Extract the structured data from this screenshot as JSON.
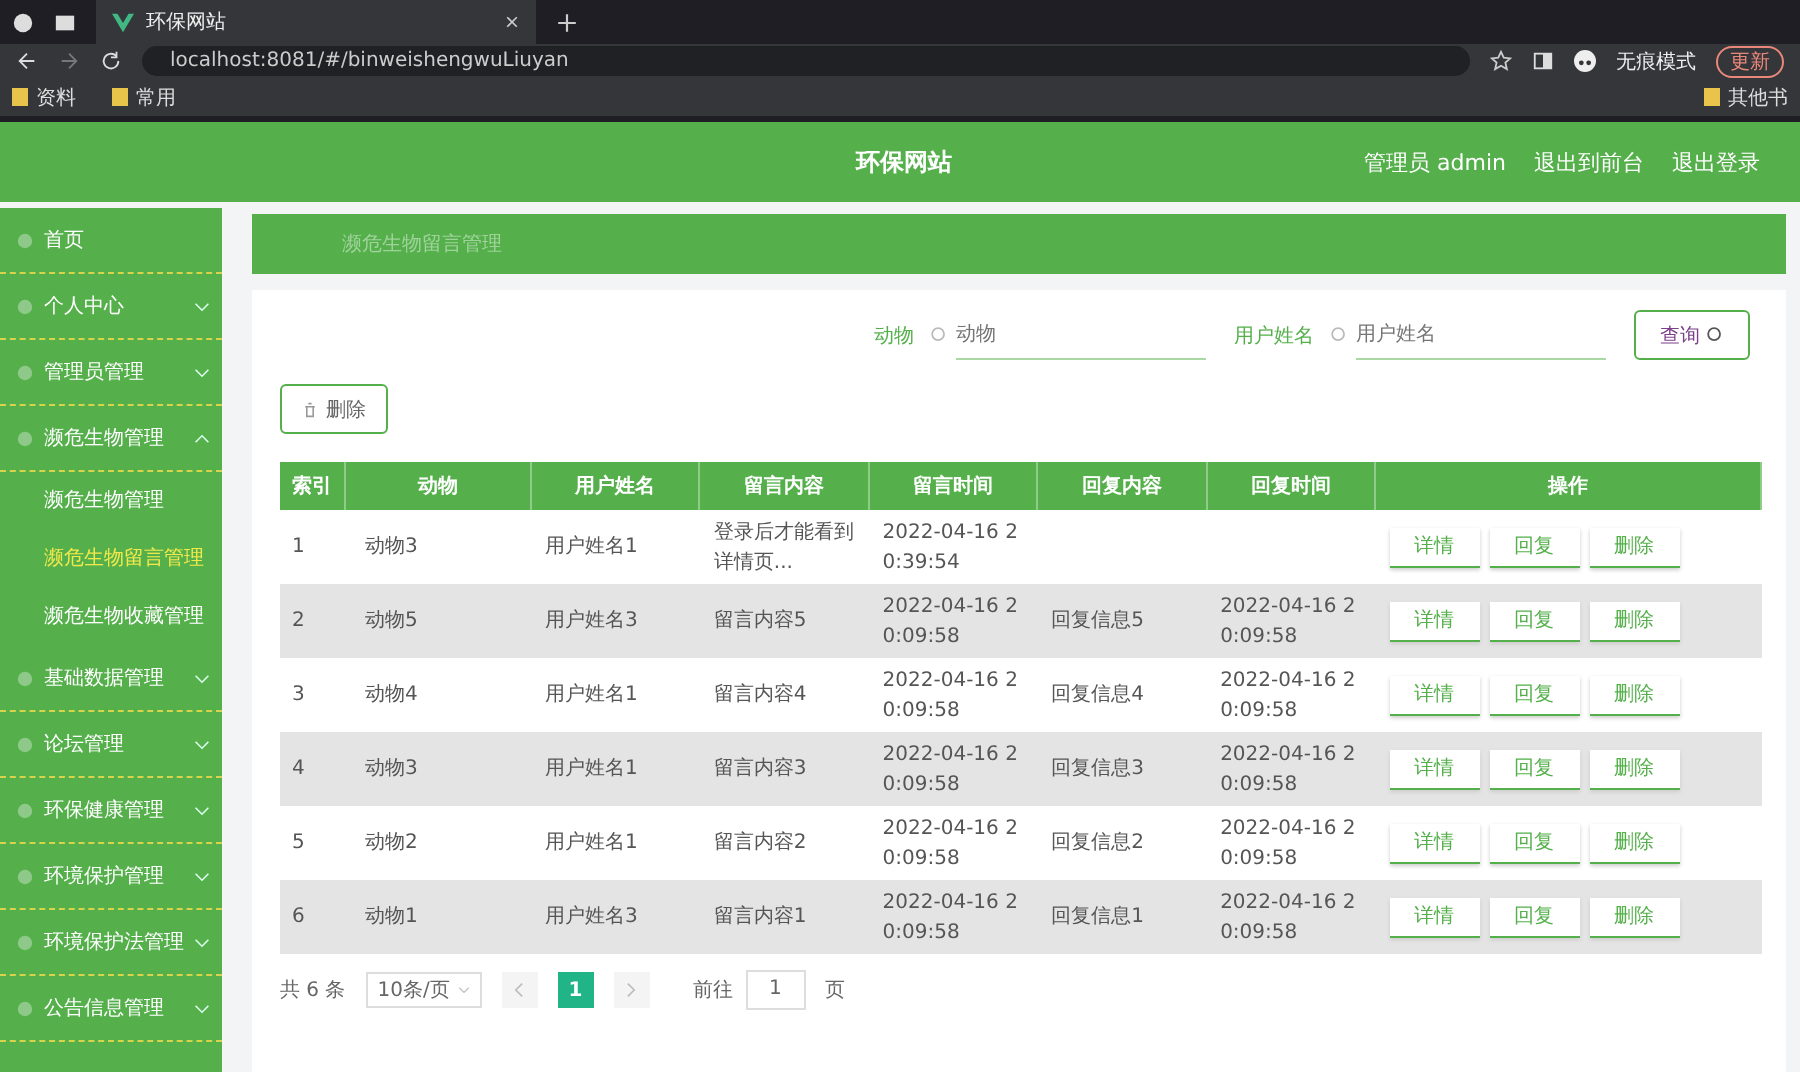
{
  "browser": {
    "tab_title": "环保网站",
    "url": "localhost:8081/#/binweishengwuLiuyan",
    "profile": "无痕模式",
    "update": "更新",
    "bookmarks": [
      "资料",
      "常用"
    ],
    "other_bookmarks": "其他书"
  },
  "header": {
    "title": "环保网站",
    "links": [
      "管理员 admin",
      "退出到前台",
      "退出登录"
    ]
  },
  "sidebar": {
    "items": [
      {
        "label": "首页"
      },
      {
        "label": "个人中心",
        "expanded": false
      },
      {
        "label": "管理员管理",
        "expanded": false
      },
      {
        "label": "濒危生物管理",
        "expanded": true,
        "children": [
          {
            "label": "濒危生物管理",
            "selected": false
          },
          {
            "label": "濒危生物留言管理",
            "selected": true
          },
          {
            "label": "濒危生物收藏管理",
            "selected": false
          }
        ]
      },
      {
        "label": "基础数据管理",
        "expanded": false
      },
      {
        "label": "论坛管理",
        "expanded": false
      },
      {
        "label": "环保健康管理",
        "expanded": false
      },
      {
        "label": "环境保护管理",
        "expanded": false
      },
      {
        "label": "环境保护法管理",
        "expanded": false
      },
      {
        "label": "公告信息管理",
        "expanded": false
      }
    ]
  },
  "breadcrumb": "濒危生物留言管理",
  "search": {
    "fields": [
      {
        "label": "动物",
        "placeholder": "动物"
      },
      {
        "label": "用户姓名",
        "placeholder": "用户姓名"
      }
    ],
    "button": "查询"
  },
  "delete_button": "删除",
  "table": {
    "columns": [
      "索引",
      "动物",
      "用户姓名",
      "留言内容",
      "留言时间",
      "回复内容",
      "回复时间",
      "操作"
    ],
    "rows": [
      {
        "cells": [
          "1",
          "动物3",
          "用户姓名1",
          "登录后才能看到详情页...",
          "2022-04-16 20:39:54",
          "",
          ""
        ],
        "actions": [
          "详情",
          "回复",
          "删除"
        ]
      },
      {
        "cells": [
          "2",
          "动物5",
          "用户姓名3",
          "留言内容5",
          "2022-04-16 20:09:58",
          "回复信息5",
          "2022-04-16 20:09:58"
        ],
        "actions": [
          "详情",
          "回复",
          "删除"
        ]
      },
      {
        "cells": [
          "3",
          "动物4",
          "用户姓名1",
          "留言内容4",
          "2022-04-16 20:09:58",
          "回复信息4",
          "2022-04-16 20:09:58"
        ],
        "actions": [
          "详情",
          "回复",
          "删除"
        ]
      },
      {
        "cells": [
          "4",
          "动物3",
          "用户姓名1",
          "留言内容3",
          "2022-04-16 20:09:58",
          "回复信息3",
          "2022-04-16 20:09:58"
        ],
        "actions": [
          "详情",
          "回复",
          "删除"
        ]
      },
      {
        "cells": [
          "5",
          "动物2",
          "用户姓名1",
          "留言内容2",
          "2022-04-16 20:09:58",
          "回复信息2",
          "2022-04-16 20:09:58"
        ],
        "actions": [
          "详情",
          "回复",
          "删除"
        ]
      },
      {
        "cells": [
          "6",
          "动物1",
          "用户姓名3",
          "留言内容1",
          "2022-04-16 20:09:58",
          "回复信息1",
          "2022-04-16 20:09:58"
        ],
        "actions": [
          "详情",
          "回复",
          "删除"
        ]
      }
    ]
  },
  "pagination": {
    "total": "共 6 条",
    "page_size": "10条/页",
    "pages": [
      {
        "label": "1",
        "selected": true
      }
    ],
    "goto_label": "前往",
    "goto_value": "1",
    "goto_suffix": "页"
  }
}
